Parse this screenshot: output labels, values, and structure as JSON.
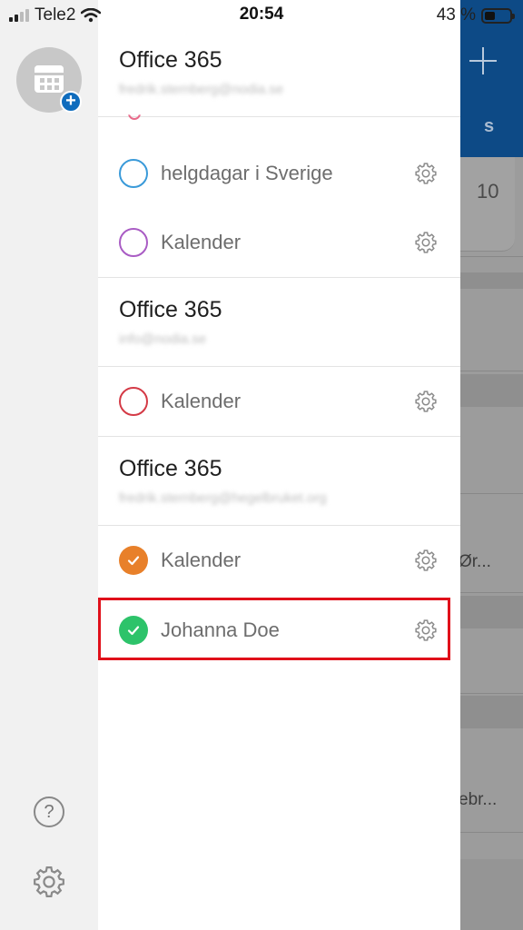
{
  "status_bar": {
    "carrier": "Tele2",
    "time": "20:54",
    "battery": "43 %"
  },
  "accounts": [
    {
      "title": "Office 365",
      "email": "fredrik.sternberg@nodia.se",
      "calendars": [
        {
          "name": "helgdagar i Sverige",
          "color": "#3a9ad9",
          "checked": false
        },
        {
          "name": "Kalender",
          "color": "#a95cc4",
          "checked": false
        }
      ]
    },
    {
      "title": "Office 365",
      "email": "info@nodia.se",
      "calendars": [
        {
          "name": "Kalender",
          "color": "#d43a46",
          "checked": false
        }
      ]
    },
    {
      "title": "Office 365",
      "email": "fredrik.sternberg@hegelbruket.org",
      "calendars": [
        {
          "name": "Kalender",
          "color": "#e8802a",
          "checked": true
        },
        {
          "name": "Johanna Doe",
          "color": "#2dc36a",
          "checked": true
        }
      ]
    }
  ],
  "rail": {
    "help_icon": "question-icon",
    "settings_icon": "gear-icon"
  },
  "background": {
    "weekday": "s",
    "day": "10",
    "event_1": "Ør...",
    "event_2": "ebr..."
  },
  "colors": {
    "accent_blue": "#0f6cbd",
    "highlight_red": "#e0101a"
  }
}
